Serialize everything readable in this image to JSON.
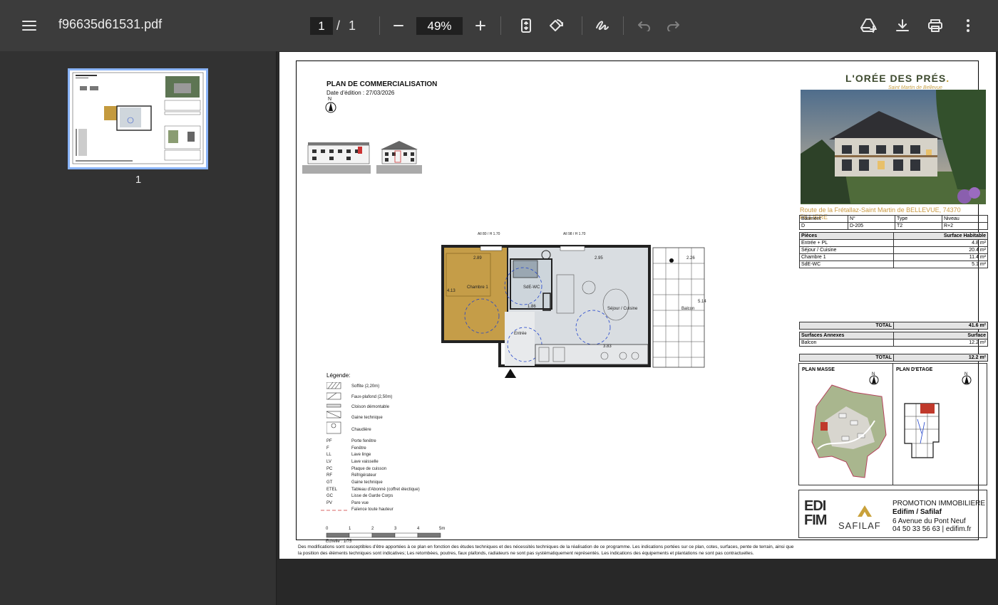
{
  "toolbar": {
    "file_name": "f96635d61531.pdf",
    "current_page": "1",
    "page_separator": "/",
    "total_pages": "1",
    "zoom": "49%"
  },
  "sidebar": {
    "thumbnails": [
      {
        "page_label": "1"
      }
    ]
  },
  "document": {
    "plan_title": "PLAN DE COMMERCIALISATION",
    "edition_date": "Date d'édition :   27/03/2026",
    "north_label": "N",
    "brand": "L'ORÉE DES PRÉS",
    "brand_dot": ".",
    "brand_sub": "Saint Martin de Bellevue",
    "address": "Route de la Frétallaz-Saint Martin de BELLEVUE, 74370 FILLIERE",
    "lot_table": {
      "headers": [
        "Bâtiment",
        "N°",
        "Type",
        "Niveau"
      ],
      "values": [
        "D",
        "D-205",
        "T2",
        "R+2"
      ]
    },
    "rooms_table": {
      "headers": [
        "Pièces",
        "Surface Habitable"
      ],
      "rows": [
        {
          "name": "Entrée + PL",
          "surface": "4.8 m²"
        },
        {
          "name": "Séjour / Cuisine",
          "surface": "20.4 m²"
        },
        {
          "name": "Chambre 1",
          "surface": "11.4 m²"
        },
        {
          "name": "SdE-WC",
          "surface": "5.1 m²"
        }
      ]
    },
    "total_label": "TOTAL",
    "total_habitable": "41.6 m²",
    "annex_table": {
      "headers": [
        "Surfaces Annexes",
        "Surface"
      ],
      "rows": [
        {
          "name": "Balcon",
          "surface": "12.2 m²"
        }
      ]
    },
    "total_annex": "12.2 m²",
    "plan_masse_label": "PLAN MASSE",
    "plan_etage_label": "PLAN D'ETAGE",
    "promoter": {
      "line1": "PROMOTION IMMOBILIERE",
      "line2": "Edifim / Safilaf",
      "line3": "6 Avenue du Pont Neuf",
      "line4": "04 50 33 56 63 | edifim.fr",
      "logo1_top": "EDI",
      "logo1_bottom": "FIM",
      "logo2": "SAFILAF"
    },
    "legend": {
      "title": "Légende:",
      "items": [
        {
          "code": "",
          "text": "Soffite (2,20m)"
        },
        {
          "code": "",
          "text": "Faux-plafond (2,50m)"
        },
        {
          "code": "",
          "text": "Cloison démontable"
        },
        {
          "code": "",
          "text": "Gaine technique"
        },
        {
          "code": "",
          "text": "Chaudière"
        },
        {
          "code": "PF",
          "text": "Porte fenêtre"
        },
        {
          "code": "F",
          "text": "Fenêtre"
        },
        {
          "code": "LL",
          "text": "Lave linge"
        },
        {
          "code": "LV",
          "text": "Lave vaisselle"
        },
        {
          "code": "PC",
          "text": "Plaque de cuisson"
        },
        {
          "code": "RF",
          "text": "Réfrigérateur"
        },
        {
          "code": "GT",
          "text": "Gaine technique"
        },
        {
          "code": "ETEL",
          "text": "Tableau d'Abonné (coffret électique)"
        },
        {
          "code": "GC",
          "text": "Lisse de Garde Corps"
        },
        {
          "code": "PV",
          "text": "Pare vue"
        },
        {
          "code": "",
          "text": "Faïence toute hauteur"
        }
      ]
    },
    "scale": {
      "ticks": [
        "0",
        "1",
        "2",
        "3",
        "4",
        "5m"
      ],
      "label": "Echelle : 1/75"
    },
    "floorplan": {
      "chambre": "Chambre 1",
      "sde": "SdE-WC",
      "sejour": "Séjour / Cuisine",
      "entree": "Entrée",
      "balcon": "Balcon",
      "dim1": "2.89",
      "dim2": "2.95",
      "dim3": "2.26",
      "dim4": "4.13",
      "dim5": "1.86",
      "dim6": "3.83",
      "dim7": "5.14",
      "window1": "All 80 / H 1.70",
      "window2": "All 98 / H 1.70"
    },
    "disclaimer": "Des modifications sont susceptibles d'être apportées à ce plan en fonction des études techniques et des nécessités techniques de la réalisation de ce programme.   Les indications portées sur ce plan, cotes, surfaces, pente de terrain, ainsi que la position des éléments techniques sont indicatives;  Les retombées, poutres, faux plafonds, radiateurs ne sont pas systématiquement représentés. Les indications des équipements et plantations ne sont pas contractuelles."
  }
}
